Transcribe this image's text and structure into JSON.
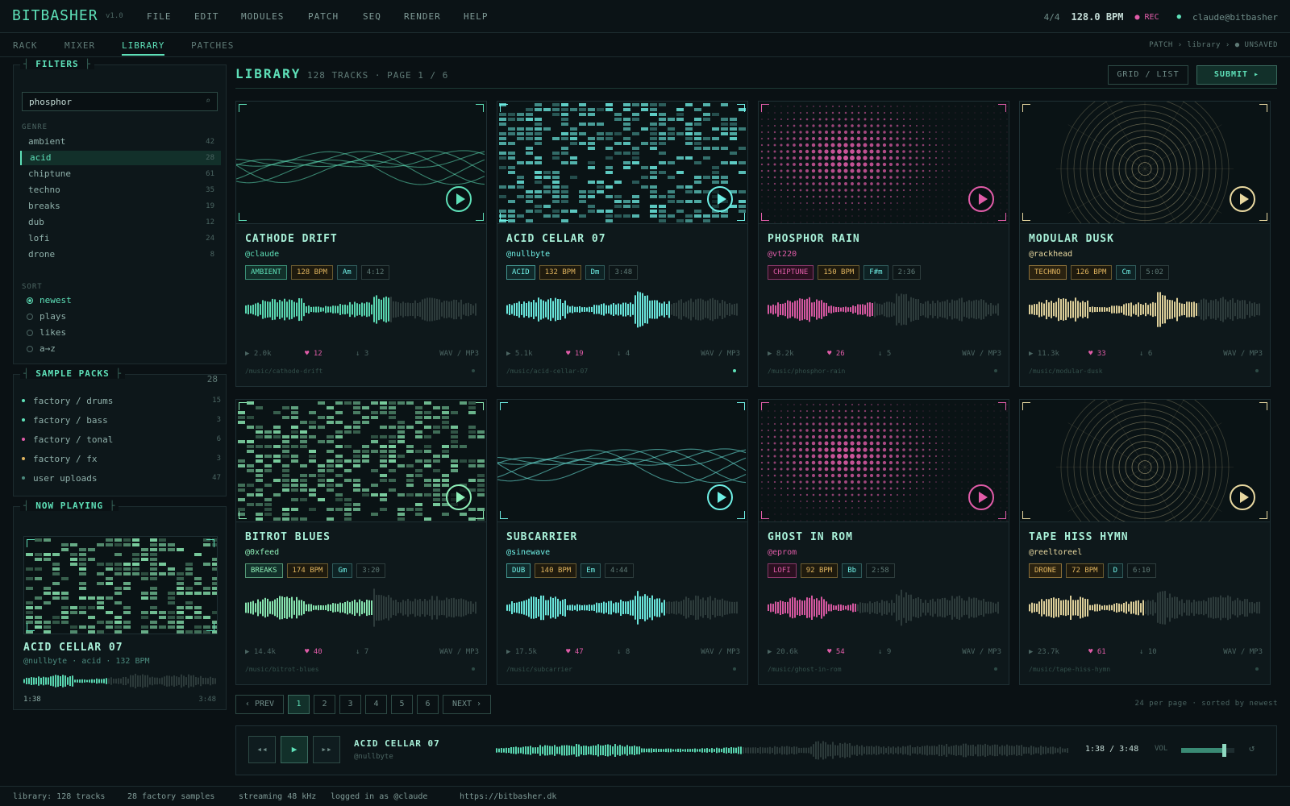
{
  "app": {
    "logo": "BITBASHER",
    "version": "v1.0"
  },
  "menu": [
    "FILE",
    "EDIT",
    "MODULES",
    "PATCH",
    "SEQ",
    "RENDER",
    "HELP"
  ],
  "transport_header": {
    "time_sig": "4/4",
    "bpm": "128.0 BPM",
    "rec": "● REC",
    "user_dot": "●",
    "user": "claude@bitbasher"
  },
  "tabs": [
    "RACK",
    "MIXER",
    "LIBRARY",
    "PATCHES"
  ],
  "active_tab": "LIBRARY",
  "breadcrumb": "PATCH › library ›   ● UNSAVED",
  "filters": {
    "title": "FILTERS",
    "search_value": "phosphor",
    "search_icon": "⌕",
    "genre_label": "GENRE",
    "genres": [
      {
        "name": "ambient",
        "count": "42"
      },
      {
        "name": "acid",
        "count": "28"
      },
      {
        "name": "chiptune",
        "count": "61"
      },
      {
        "name": "techno",
        "count": "35"
      },
      {
        "name": "breaks",
        "count": "19"
      },
      {
        "name": "dub",
        "count": "12"
      },
      {
        "name": "lofi",
        "count": "24"
      },
      {
        "name": "drone",
        "count": "8"
      }
    ],
    "selected_genre": "acid",
    "sort_label": "SORT",
    "sort_options": [
      "newest",
      "plays",
      "likes",
      "a→z"
    ],
    "sort_selected": "newest"
  },
  "sample_packs": {
    "title": "SAMPLE PACKS",
    "total": "28",
    "items": [
      {
        "name": "factory / drums",
        "count": "15",
        "color": "#5ee0b8"
      },
      {
        "name": "factory / bass",
        "count": "3",
        "color": "#5ee0b8"
      },
      {
        "name": "factory / tonal",
        "count": "6",
        "color": "#e05ca8"
      },
      {
        "name": "factory / fx",
        "count": "3",
        "color": "#e0b45e"
      },
      {
        "name": "user uploads",
        "count": "47",
        "color": "#4b8a7e"
      }
    ]
  },
  "now_playing": {
    "title": "NOW PLAYING",
    "track": "ACID CELLAR 07",
    "meta": "@nullbyte · acid · 132 BPM",
    "elapsed": "1:38",
    "duration": "3:48",
    "progress": 0.43
  },
  "library": {
    "title": "LIBRARY",
    "subtitle": "128 TRACKS · PAGE 1 / 6",
    "view_toggle": "GRID / LIST",
    "submit": "SUBMIT ▸"
  },
  "tracks": [
    {
      "title": "CATHODE DRIFT",
      "author": "@claude",
      "genre": "AMBIENT",
      "bpm": "128 BPM",
      "key": "Am",
      "length": "4:12",
      "plays": "▶ 2.0k",
      "likes": "♥ 12",
      "downloads": "↓ 3",
      "formats": "WAV / MP3",
      "path": "/music/cathode-drift",
      "accent": "#5ee0b8",
      "art": "waves",
      "progress": 0.62
    },
    {
      "title": "ACID CELLAR 07",
      "author": "@nullbyte",
      "genre": "ACID",
      "bpm": "132 BPM",
      "key": "Dm",
      "length": "3:48",
      "plays": "▶ 5.1k",
      "likes": "♥ 19",
      "downloads": "↓ 4",
      "formats": "WAV / MP3",
      "path": "/music/acid-cellar-07",
      "accent": "#6ff0e6",
      "art": "blocks",
      "progress": 0.7
    },
    {
      "title": "PHOSPHOR RAIN",
      "author": "@vt220",
      "genre": "CHIPTUNE",
      "bpm": "150 BPM",
      "key": "F#m",
      "length": "2:36",
      "plays": "▶ 8.2k",
      "likes": "♥ 26",
      "downloads": "↓ 5",
      "formats": "WAV / MP3",
      "path": "/music/phosphor-rain",
      "accent": "#e05ca8",
      "art": "dots",
      "progress": 0.45
    },
    {
      "title": "MODULAR DUSK",
      "author": "@rackhead",
      "genre": "TECHNO",
      "bpm": "126 BPM",
      "key": "Cm",
      "length": "5:02",
      "plays": "▶ 11.3k",
      "likes": "♥ 33",
      "downloads": "↓ 6",
      "formats": "WAV / MP3",
      "path": "/music/modular-dusk",
      "accent": "#e8d8a0",
      "art": "rings",
      "progress": 0.72
    },
    {
      "title": "BITROT BLUES",
      "author": "@0xfeed",
      "genre": "BREAKS",
      "bpm": "174 BPM",
      "key": "Gm",
      "length": "3:20",
      "plays": "▶ 14.4k",
      "likes": "♥ 40",
      "downloads": "↓ 7",
      "formats": "WAV / MP3",
      "path": "/music/bitrot-blues",
      "accent": "#8ff0b8",
      "art": "blocks",
      "progress": 0.55
    },
    {
      "title": "SUBCARRIER",
      "author": "@sinewave",
      "genre": "DUB",
      "bpm": "140 BPM",
      "key": "Em",
      "length": "4:44",
      "plays": "▶ 17.5k",
      "likes": "♥ 47",
      "downloads": "↓ 8",
      "formats": "WAV / MP3",
      "path": "/music/subcarrier",
      "accent": "#6ff0e6",
      "art": "waves",
      "progress": 0.68
    },
    {
      "title": "GHOST IN ROM",
      "author": "@eprom",
      "genre": "LOFI",
      "bpm": "92 BPM",
      "key": "Bb",
      "length": "2:58",
      "plays": "▶ 20.6k",
      "likes": "♥ 54",
      "downloads": "↓ 9",
      "formats": "WAV / MP3",
      "path": "/music/ghost-in-rom",
      "accent": "#e05ca8",
      "art": "dots",
      "progress": 0.38
    },
    {
      "title": "TAPE HISS HYMN",
      "author": "@reeltoreel",
      "genre": "DRONE",
      "bpm": "72 BPM",
      "key": "D",
      "length": "6:10",
      "plays": "▶ 23.7k",
      "likes": "♥ 61",
      "downloads": "↓ 10",
      "formats": "WAV / MP3",
      "path": "/music/tape-hiss-hymn",
      "accent": "#e8d8a0",
      "art": "rings",
      "progress": 0.5
    }
  ],
  "pagination": {
    "prev": "‹ PREV",
    "pages": [
      "1",
      "2",
      "3",
      "4",
      "5",
      "6"
    ],
    "current": "1",
    "next": "NEXT ›",
    "info": "24 per page · sorted by newest"
  },
  "player": {
    "rewind": "◂◂",
    "play": "▶",
    "forward": "▸▸",
    "track": "ACID CELLAR 07",
    "author": "@nullbyte",
    "time": "1:38 / 3:48",
    "progress": 0.43,
    "vol_label": "VOL",
    "volume": 0.8,
    "loop": "↺"
  },
  "statusbar": [
    "library: 128 tracks",
    "28 factory samples",
    "streaming 48 kHz",
    "logged in as @claude",
    "https://bitbasher.dk"
  ],
  "colors": {
    "accent": "#5ee0b8",
    "pink": "#e05ca8",
    "gold": "#e0b45e",
    "cream": "#e8d8a0",
    "cyan": "#6ff0e6"
  }
}
